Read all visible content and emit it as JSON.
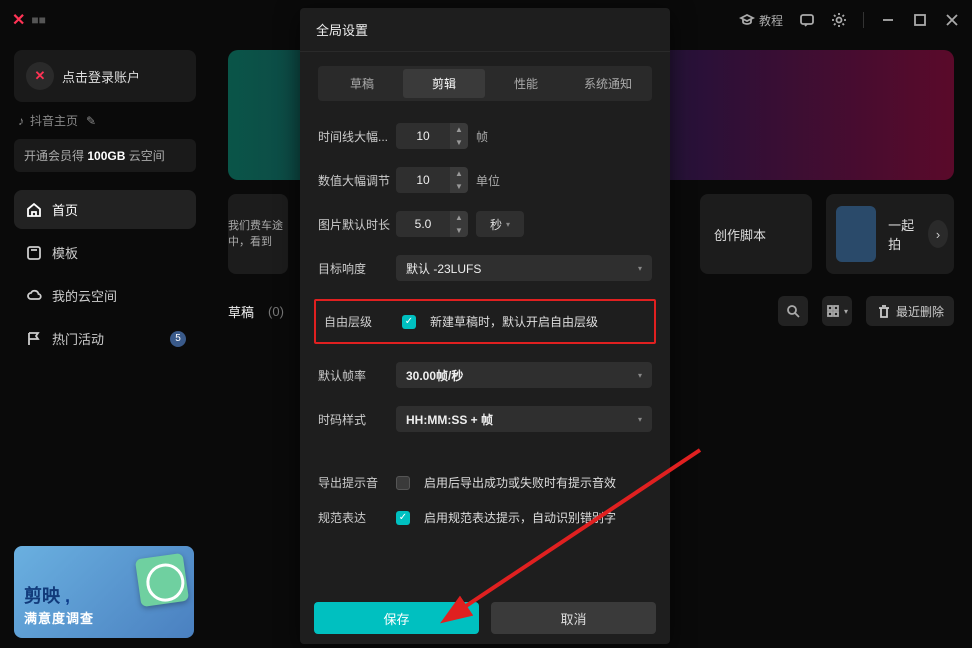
{
  "app": {
    "name_masked": "■■"
  },
  "titlebar": {
    "tutorial": "教程"
  },
  "sidebar": {
    "login": "点击登录账户",
    "tiktok_home": "抖音主页",
    "cloud_promo_prefix": "开通会员得 ",
    "cloud_promo_bold": "100GB",
    "cloud_promo_suffix": " 云空间",
    "nav": {
      "home": "首页",
      "templates": "模板",
      "cloud": "我的云空间",
      "hot": "热门活动",
      "hot_badge": "5"
    },
    "promo": {
      "title": "剪映",
      "sub": "满意度调查"
    }
  },
  "content": {
    "freecar_msg": "我们费车途中，看到",
    "create_script": "创作脚本",
    "batch_shoot": "一起拍",
    "drafts_label": "草稿",
    "drafts_count": "(0)",
    "recent_delete": "最近删除"
  },
  "modal": {
    "title": "全局设置",
    "tabs": {
      "draft": "草稿",
      "edit": "剪辑",
      "perf": "性能",
      "notify": "系统通知"
    },
    "rows": {
      "timeline_jump": {
        "label": "时间线大幅...",
        "value": "10",
        "unit": "帧"
      },
      "value_jump": {
        "label": "数值大幅调节",
        "value": "10",
        "unit": "单位"
      },
      "image_duration": {
        "label": "图片默认时长",
        "value": "5.0",
        "unit": "秒"
      },
      "target_loudness": {
        "label": "目标响度",
        "value": "默认 -23LUFS"
      },
      "free_layer": {
        "label": "自由层级",
        "text": "新建草稿时，默认开启自由层级"
      },
      "default_fps": {
        "label": "默认帧率",
        "value": "30.00帧/秒"
      },
      "timecode": {
        "label": "时码样式",
        "value": "HH:MM:SS + 帧"
      },
      "export_sound": {
        "label": "导出提示音",
        "text": "启用后导出成功或失败时有提示音效"
      },
      "typo": {
        "label": "规范表达",
        "text": "启用规范表达提示，自动识别错别字"
      }
    },
    "footer": {
      "save": "保存",
      "cancel": "取消"
    }
  }
}
